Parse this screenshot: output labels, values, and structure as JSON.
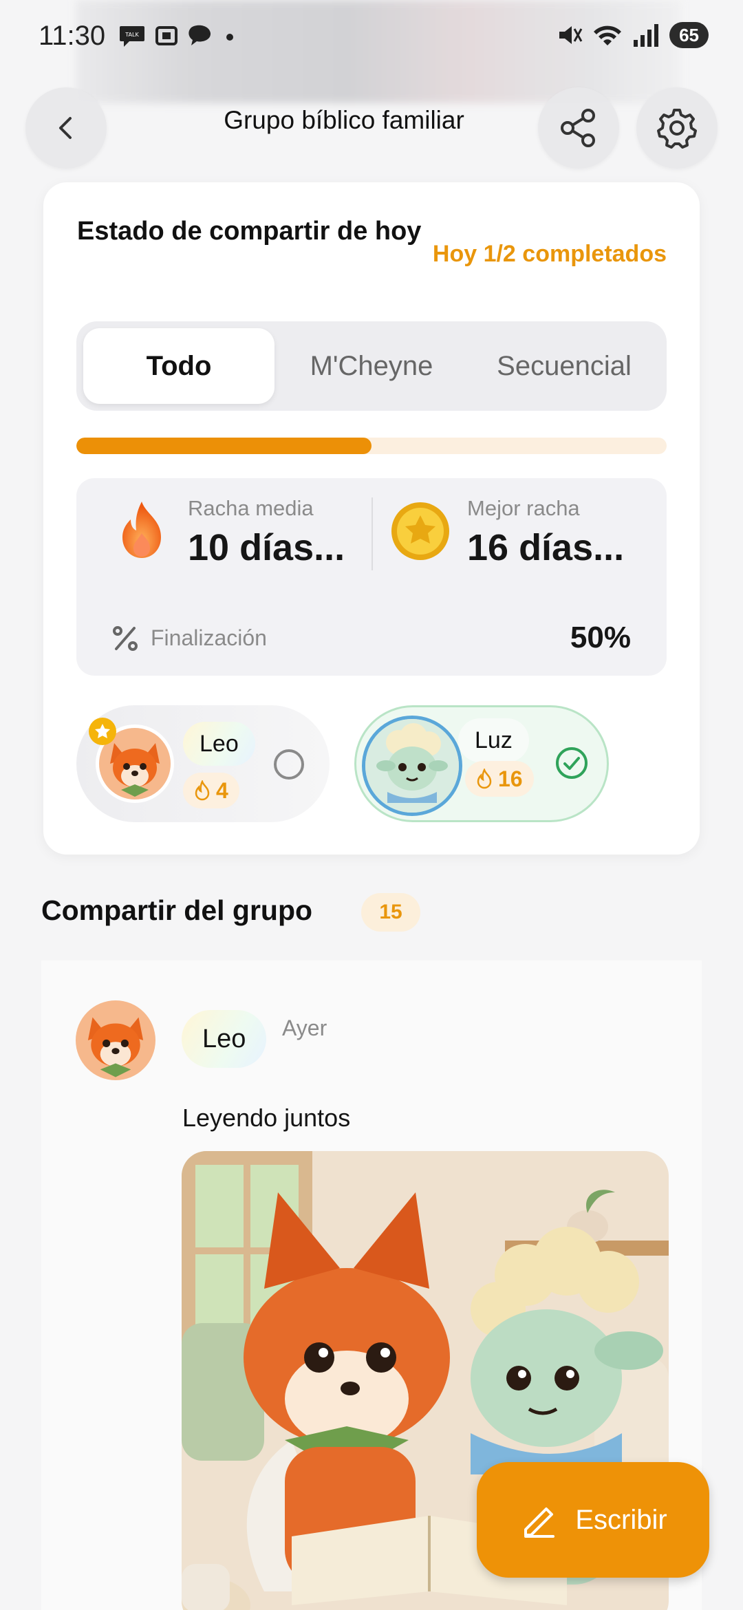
{
  "status_bar": {
    "time": "11:30",
    "battery": "65",
    "icons_left": [
      "talk-icon",
      "screen-capture-icon",
      "chat-bubble-icon",
      "dot-icon"
    ],
    "icons_right": [
      "mute-icon",
      "wifi-icon",
      "signal-icon"
    ]
  },
  "header": {
    "title": "Grupo bíblico familiar",
    "back_icon": "chevron-left-icon",
    "share_icon": "share-icon",
    "settings_icon": "gear-icon"
  },
  "status_card": {
    "title": "Estado de compartir de hoy",
    "progress_text": "Hoy 1/2 completados",
    "progress": 0.5,
    "tabs": [
      {
        "label": "Todo",
        "active": true
      },
      {
        "label": "M'Cheyne",
        "active": false
      },
      {
        "label": "Secuencial",
        "active": false
      }
    ],
    "stats": {
      "avg_label": "Racha media",
      "avg_value": "10 días...",
      "best_label": "Mejor racha",
      "best_value": "16 días...",
      "completion_label": "Finalización",
      "completion_value": "50%"
    },
    "members": [
      {
        "name": "Leo",
        "streak": "4",
        "done": false
      },
      {
        "name": "Luz",
        "streak": "16",
        "done": true
      }
    ]
  },
  "group": {
    "title": "Compartir del grupo",
    "count": "15",
    "post": {
      "author": "Leo",
      "time": "Ayer",
      "text": "Leyendo juntos"
    }
  },
  "fab": {
    "label": "Escribir"
  },
  "colors": {
    "accent": "#ee9207",
    "success": "#2fa35a"
  }
}
